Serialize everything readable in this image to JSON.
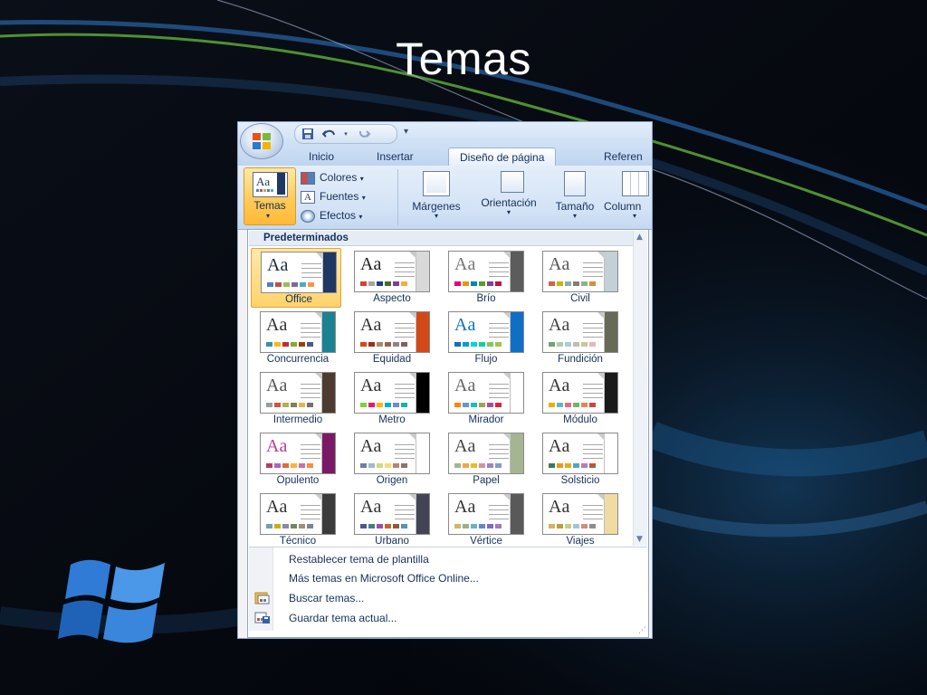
{
  "slide": {
    "title": "Temas"
  },
  "qat": {
    "save_icon": "save-icon",
    "undo_icon": "undo-icon",
    "redo_icon": "redo-icon"
  },
  "tabs": [
    {
      "label": "Inicio"
    },
    {
      "label": "Insertar"
    },
    {
      "label": "Diseño de página",
      "active": true
    },
    {
      "label": "Referen"
    }
  ],
  "ribbon": {
    "temas_label": "Temas",
    "colores_label": "Colores",
    "fuentes_label": "Fuentes",
    "efectos_label": "Efectos",
    "margenes_label": "Márgenes",
    "orientacion_label": "Orientación",
    "tamano_label": "Tamaño",
    "columnas_label": "Column"
  },
  "gallery": {
    "section_title": "Predeterminados",
    "selected": "Office",
    "themes": [
      {
        "name": "Office",
        "side": "#1f3763",
        "aa": "#1f2a44",
        "swatches": [
          "#4f81bd",
          "#c0504d",
          "#9bbb59",
          "#8064a2",
          "#4bacc6",
          "#f79646"
        ]
      },
      {
        "name": "Aspecto",
        "side": "#d9d9d9",
        "aa": "#222222",
        "swatches": [
          "#e03c31",
          "#a5a5a5",
          "#1d3f87",
          "#4b6c2a",
          "#7f3f98",
          "#f2b134"
        ]
      },
      {
        "name": "Brío",
        "side": "#5c5c5c",
        "aa": "#777777",
        "swatches": [
          "#e4007c",
          "#f49100",
          "#0082c8",
          "#54a021",
          "#8b3a9e",
          "#c0143c"
        ]
      },
      {
        "name": "Civil",
        "side": "#c3d0d6",
        "aa": "#555555",
        "swatches": [
          "#d16349",
          "#ccb400",
          "#8cadae",
          "#8c7b70",
          "#8fb08c",
          "#d19049"
        ]
      },
      {
        "name": "Concurrencia",
        "side": "#1a8290",
        "aa": "#333333",
        "swatches": [
          "#3891a7",
          "#feb80a",
          "#c32d2e",
          "#84aa33",
          "#964305",
          "#475a8d"
        ]
      },
      {
        "name": "Equidad",
        "side": "#d34817",
        "aa": "#333333",
        "swatches": [
          "#d34817",
          "#9b2d1f",
          "#a28e6a",
          "#956251",
          "#918485",
          "#855d5d"
        ]
      },
      {
        "name": "Flujo",
        "side": "#0f6fc6",
        "aa": "#0f6fc6",
        "swatches": [
          "#0f6fc6",
          "#009dd9",
          "#0bd0d9",
          "#10cf9b",
          "#7cca62",
          "#a5c249"
        ]
      },
      {
        "name": "Fundición",
        "side": "#676a55",
        "aa": "#444444",
        "swatches": [
          "#72a376",
          "#b0ccb0",
          "#a8cdd7",
          "#c0beaf",
          "#cec597",
          "#e8b7b7"
        ]
      },
      {
        "name": "Intermedio",
        "side": "#4e3b30",
        "aa": "#555555",
        "swatches": [
          "#93a299",
          "#cf543f",
          "#b5ae53",
          "#848058",
          "#e8b54d",
          "#786c71"
        ]
      },
      {
        "name": "Metro",
        "side": "#000000",
        "aa": "#333333",
        "swatches": [
          "#7fd13b",
          "#ea157a",
          "#feb80a",
          "#00addc",
          "#738ac8",
          "#1ab39f"
        ]
      },
      {
        "name": "Mirador",
        "side": "#ffffff",
        "aa": "#666666",
        "swatches": [
          "#ff8600",
          "#6599c9",
          "#15c1b4",
          "#a39f53",
          "#ac4e97",
          "#cc2a41"
        ]
      },
      {
        "name": "Módulo",
        "side": "#1a1a1a",
        "aa": "#333333",
        "swatches": [
          "#f0ad00",
          "#60b5cc",
          "#e66c7d",
          "#6bb76d",
          "#e88651",
          "#c64847"
        ]
      },
      {
        "name": "Opulento",
        "side": "#7a1a66",
        "aa": "#b83d99",
        "swatches": [
          "#b83d68",
          "#ac66bb",
          "#de6c36",
          "#f9b639",
          "#cf6da4",
          "#fa8d3d"
        ]
      },
      {
        "name": "Origen",
        "side": "#ffffff",
        "aa": "#333333",
        "swatches": [
          "#727ca3",
          "#9fb8cd",
          "#d2da7a",
          "#fada7a",
          "#b88472",
          "#8e736a"
        ]
      },
      {
        "name": "Papel",
        "side": "#a5b592",
        "aa": "#444444",
        "swatches": [
          "#a5b592",
          "#f3a447",
          "#e7bc29",
          "#d092a7",
          "#9c85c0",
          "#809ec2"
        ]
      },
      {
        "name": "Solsticio",
        "side": "#ffffff",
        "aa": "#333333",
        "swatches": [
          "#3b7a57",
          "#e59a17",
          "#ddaf1c",
          "#4ea8c3",
          "#b67bbd",
          "#b55b3b"
        ]
      },
      {
        "name": "Técnico",
        "side": "#3b3b3b",
        "aa": "#333333",
        "swatches": [
          "#6ea0b0",
          "#ccaf0a",
          "#8d89a4",
          "#748560",
          "#9e9273",
          "#7e848d"
        ]
      },
      {
        "name": "Urbano",
        "side": "#424456",
        "aa": "#333333",
        "swatches": [
          "#53548a",
          "#438086",
          "#a04da3",
          "#c4652d",
          "#8b5d3d",
          "#5c92b5"
        ]
      },
      {
        "name": "Vértice",
        "side": "#595959",
        "aa": "#333333",
        "swatches": [
          "#ceb966",
          "#9cb084",
          "#6bb1c9",
          "#6585cf",
          "#7e6bc9",
          "#a379bb"
        ]
      },
      {
        "name": "Viajes",
        "side": "#f0dca0",
        "aa": "#333333",
        "swatches": [
          "#d8b25c",
          "#bf9b3e",
          "#c4cf84",
          "#a7c4d5",
          "#d58c76",
          "#8e8e8e"
        ]
      }
    ]
  },
  "menu": {
    "items": [
      {
        "label": "Restablecer tema de plantilla",
        "icon": ""
      },
      {
        "label": "Más temas en Microsoft Office Online...",
        "icon": ""
      },
      {
        "label": "Buscar temas...",
        "icon": "browse-themes-icon"
      },
      {
        "label": "Guardar tema actual...",
        "icon": "save-theme-icon"
      }
    ]
  }
}
